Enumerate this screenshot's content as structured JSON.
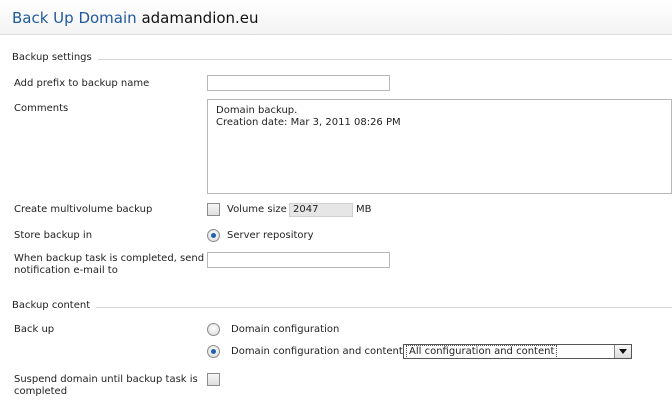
{
  "header": {
    "title_prefix": "Back Up Domain",
    "domain_name": "adamandion.eu"
  },
  "sections": {
    "backup_settings": "Backup settings",
    "backup_content": "Backup content"
  },
  "fields": {
    "prefix_label": "Add prefix to backup name",
    "prefix_value": "",
    "comments_label": "Comments",
    "comments_line1": "Domain  backup.",
    "comments_line2": "Creation date: Mar 3, 2011 08:26 PM",
    "multivolume_label": "Create multivolume backup",
    "volume_size_label": "Volume size",
    "volume_size_value": "2047",
    "volume_unit": "MB",
    "store_label": "Store backup in",
    "store_option": "Server repository",
    "notify_label_line1": "When backup task is completed, send",
    "notify_label_line2": "notification e-mail to",
    "notify_value": ""
  },
  "content": {
    "backup_label": "Back up",
    "option_config": "Domain configuration",
    "option_config_content": "Domain configuration and content",
    "select_value": "All configuration and content",
    "suspend_label_line1": "Suspend domain until backup task is",
    "suspend_label_line2": "completed"
  }
}
